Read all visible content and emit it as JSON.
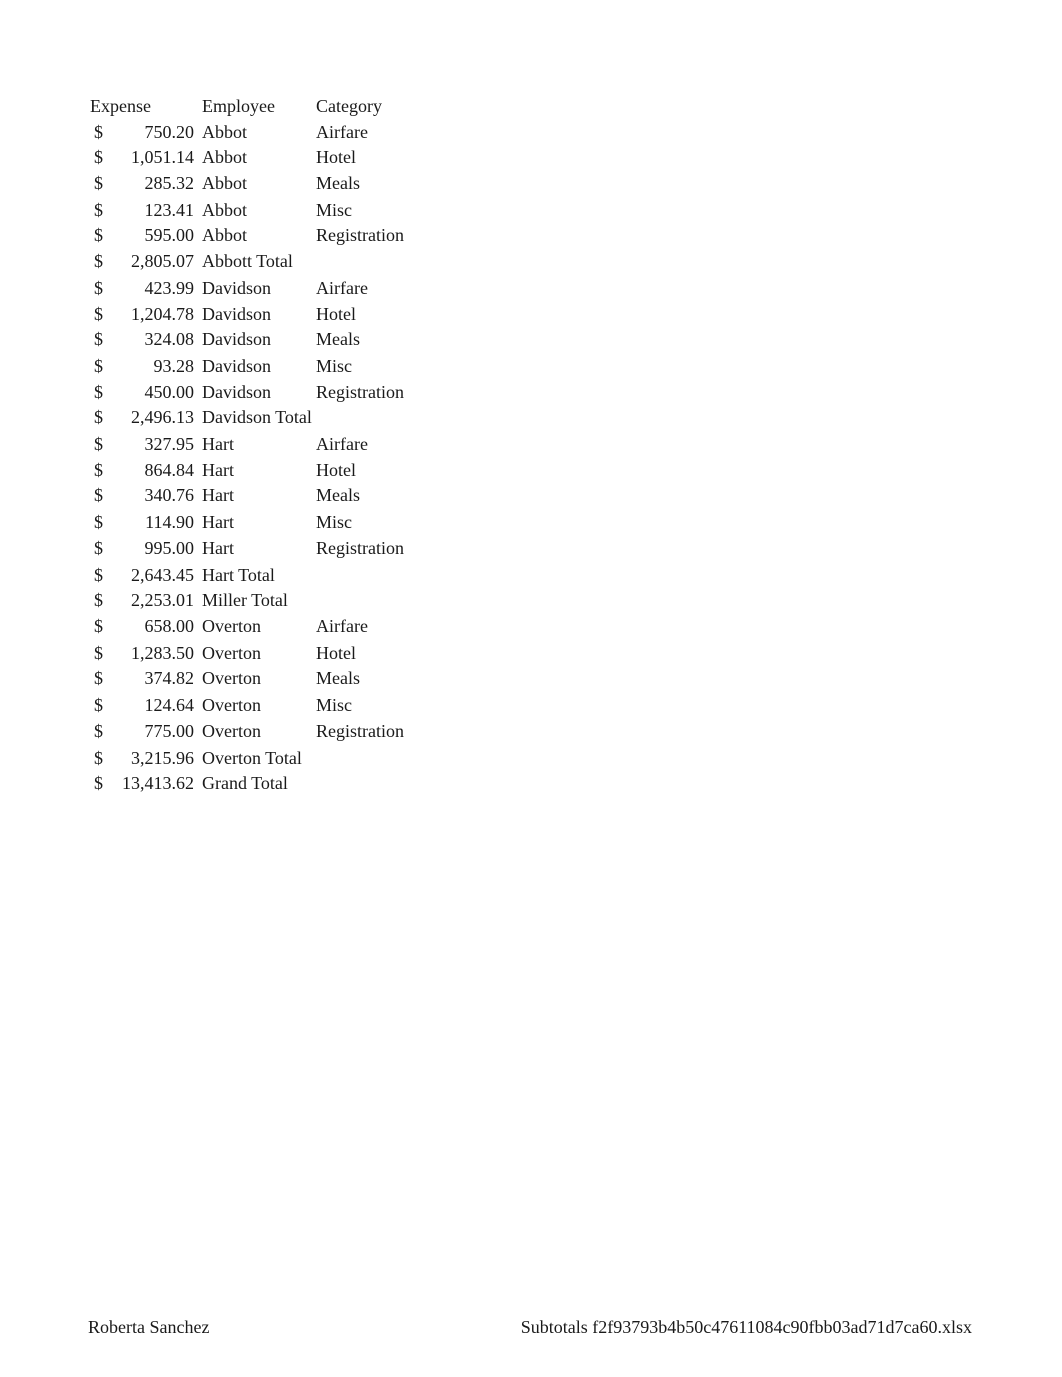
{
  "headers": {
    "expense": "Expense",
    "employee": "Employee",
    "category": "Category"
  },
  "currency_symbol": "$",
  "rows": [
    {
      "amount": "750.20",
      "employee": "Abbot",
      "category": "Airfare"
    },
    {
      "amount": "1,051.14",
      "employee": "Abbot",
      "category": "Hotel"
    },
    {
      "amount": "285.32",
      "employee": "Abbot",
      "category": "Meals"
    },
    {
      "amount": "123.41",
      "employee": "Abbot",
      "category": "Misc"
    },
    {
      "amount": "595.00",
      "employee": "Abbot",
      "category": "Registration"
    },
    {
      "amount": "2,805.07",
      "employee": "Abbott Total",
      "category": ""
    },
    {
      "amount": "423.99",
      "employee": "Davidson",
      "category": "Airfare"
    },
    {
      "amount": "1,204.78",
      "employee": "Davidson",
      "category": "Hotel"
    },
    {
      "amount": "324.08",
      "employee": "Davidson",
      "category": "Meals"
    },
    {
      "amount": "93.28",
      "employee": "Davidson",
      "category": "Misc"
    },
    {
      "amount": "450.00",
      "employee": "Davidson",
      "category": "Registration"
    },
    {
      "amount": "2,496.13",
      "employee": "Davidson Total",
      "category": ""
    },
    {
      "amount": "327.95",
      "employee": "Hart",
      "category": "Airfare"
    },
    {
      "amount": "864.84",
      "employee": "Hart",
      "category": "Hotel"
    },
    {
      "amount": "340.76",
      "employee": "Hart",
      "category": "Meals"
    },
    {
      "amount": "114.90",
      "employee": "Hart",
      "category": "Misc"
    },
    {
      "amount": "995.00",
      "employee": "Hart",
      "category": "Registration"
    },
    {
      "amount": "2,643.45",
      "employee": "Hart Total",
      "category": ""
    },
    {
      "amount": "2,253.01",
      "employee": "Miller Total",
      "category": ""
    },
    {
      "amount": "658.00",
      "employee": "Overton",
      "category": "Airfare"
    },
    {
      "amount": "1,283.50",
      "employee": "Overton",
      "category": "Hotel"
    },
    {
      "amount": "374.82",
      "employee": "Overton",
      "category": "Meals"
    },
    {
      "amount": "124.64",
      "employee": "Overton",
      "category": "Misc"
    },
    {
      "amount": "775.00",
      "employee": "Overton",
      "category": "Registration"
    },
    {
      "amount": "3,215.96",
      "employee": "Overton Total",
      "category": ""
    },
    {
      "amount": "13,413.62",
      "employee": "Grand Total",
      "category": ""
    }
  ],
  "footer": {
    "author": "Roberta Sanchez",
    "filename": "Subtotals f2f93793b4b50c47611084c90fbb03ad71d7ca60.xlsx"
  }
}
